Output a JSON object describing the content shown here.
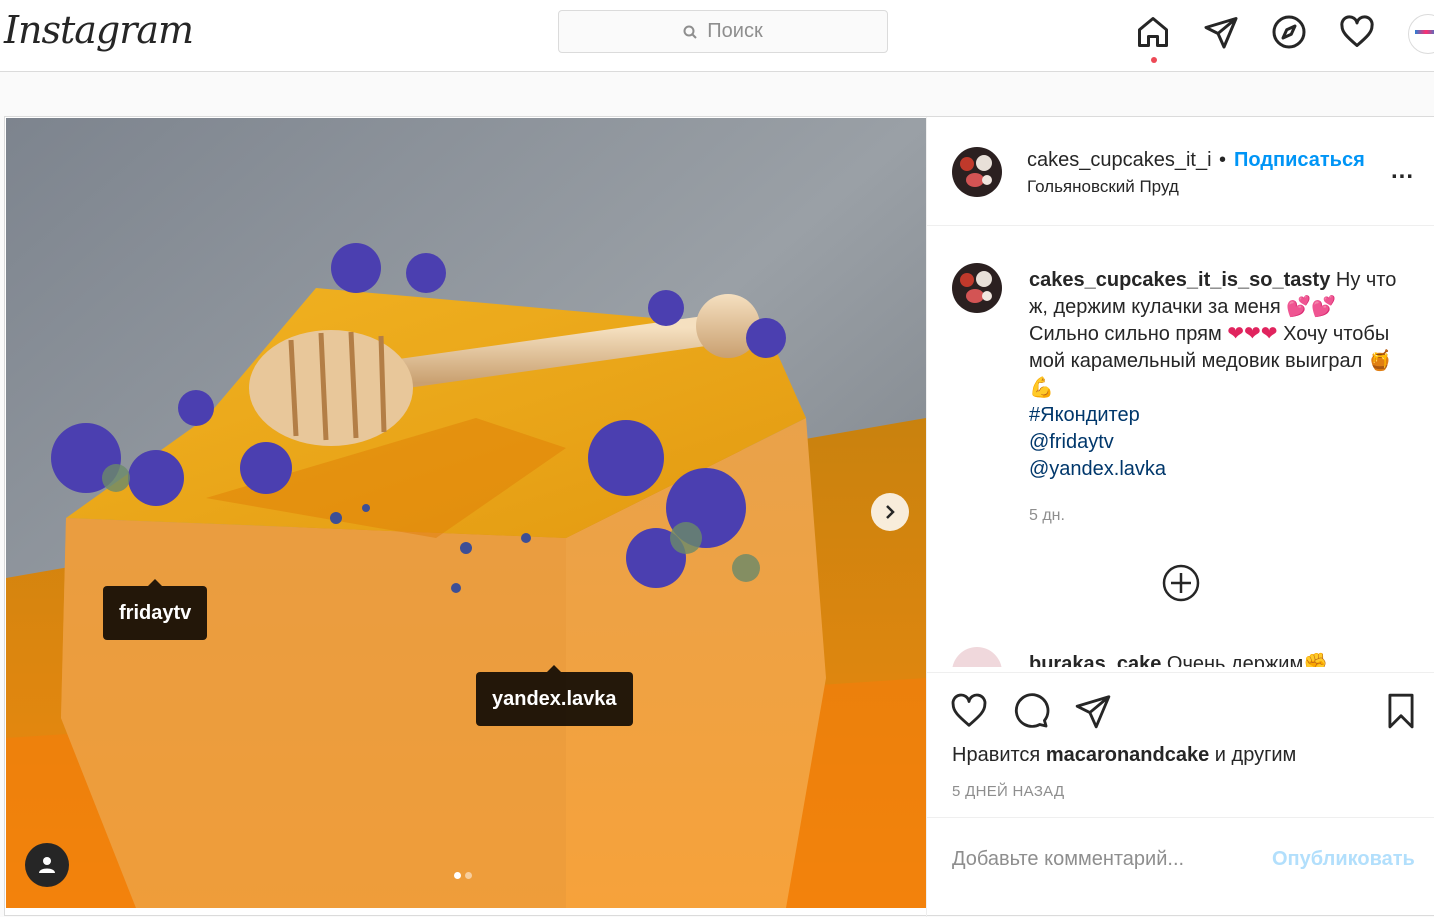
{
  "nav": {
    "logo": "Instagram",
    "search_placeholder": "Поиск",
    "icons": [
      "home-icon",
      "direct-icon",
      "explore-icon",
      "activity-heart-icon",
      "profile-avatar"
    ]
  },
  "post": {
    "tags": [
      {
        "label": "fridaytv"
      },
      {
        "label": "yandex.lavka"
      }
    ],
    "carousel": {
      "total": 2,
      "active": 1
    }
  },
  "header": {
    "username": "cakes_cupcakes_it_i",
    "separator": "•",
    "follow": "Подписаться",
    "location": "Гольяновский Пруд",
    "more": "..."
  },
  "caption": {
    "username": "cakes_cupcakes_it_is_so_tasty",
    "text1": " Ну что ж, держим кулачки за меня ",
    "hearts1": "💕💕",
    "text2": " Сильно сильно прям ",
    "hearts2": "❤❤❤",
    "text3": " Хочу чтобы мой карамельный медовик выиграл ",
    "emoji3": "🍯 💪",
    "hashtag": "#Якондитер",
    "mention1": "@fridaytv",
    "mention2": "@yandex.lavka",
    "time": "5 дн."
  },
  "second_comment": {
    "username": "burakas_cake",
    "text": " Очень держим✊"
  },
  "actions": {
    "likes_prefix": "Нравится ",
    "likes_user": "macaronandcake",
    "likes_suffix": " и другим",
    "date": "5 ДНЕЙ НАЗАД"
  },
  "comment_box": {
    "placeholder": "Добавьте комментарий...",
    "publish": "Опубликовать"
  },
  "colors": {
    "link_blue": "#0095f6",
    "notification_red": "#ed4956",
    "publish_disabled": "#b2dffc"
  }
}
